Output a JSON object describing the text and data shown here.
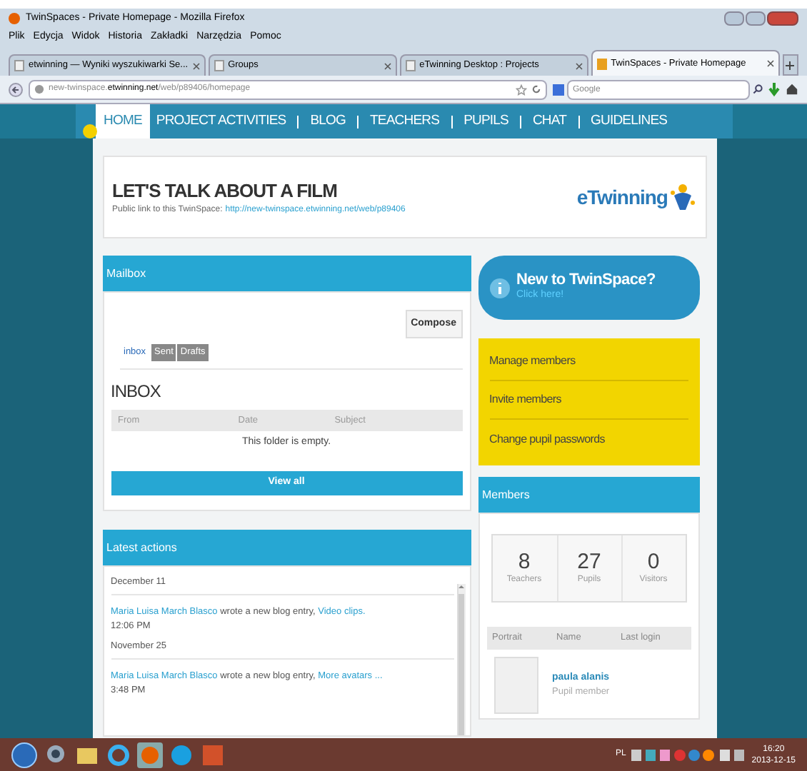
{
  "window": {
    "title": "TwinSpaces - Private Homepage - Mozilla Firefox"
  },
  "menu": [
    "Plik",
    "Edycja",
    "Widok",
    "Historia",
    "Zakładki",
    "Narzędzia",
    "Pomoc"
  ],
  "tabs": [
    {
      "label": "etwinning — Wyniki wyszukiwarki Se...",
      "selected": false
    },
    {
      "label": "Groups",
      "selected": false
    },
    {
      "label": "eTwinning Desktop : Projects",
      "selected": false
    },
    {
      "label": "TwinSpaces - Private Homepage",
      "selected": true
    }
  ],
  "address": {
    "host_prefix": "new-twinspace.",
    "host": "etwinning.net",
    "path": "/web/p89406/homepage"
  },
  "search": {
    "placeholder": "Google"
  },
  "nav": [
    {
      "label": "HOME",
      "selected": true
    },
    {
      "label": "PROJECT ACTIVITIES",
      "selected": false
    },
    {
      "label": "BLOG",
      "selected": false
    },
    {
      "label": "TEACHERS",
      "selected": false
    },
    {
      "label": "PUPILS",
      "selected": false
    },
    {
      "label": "CHAT",
      "selected": false
    },
    {
      "label": "GUIDELINES",
      "selected": false
    }
  ],
  "header": {
    "title": "LET'S TALK ABOUT A FILM",
    "link_label": "Public link to this TwinSpace:",
    "link": "http://new-twinspace.etwinning.net/web/p89406",
    "logo": "eTwinning"
  },
  "mailbox": {
    "title": "Mailbox",
    "compose": "Compose",
    "tabs": [
      {
        "label": "inbox",
        "selected": true
      },
      {
        "label": "Sent",
        "selected": false
      },
      {
        "label": "Drafts",
        "selected": false
      }
    ],
    "heading": "INBOX",
    "columns": [
      "From",
      "Date",
      "Subject"
    ],
    "empty": "This folder is empty.",
    "view_all": "View all"
  },
  "latest": {
    "title": "Latest actions",
    "entries": [
      {
        "date": "December 11",
        "author": "Maria Luisa March Blasco",
        "action": "wrote a new blog entry,",
        "link": "Video clips.",
        "time": "12:06 PM"
      },
      {
        "date": "November 25",
        "author": "Maria Luisa March Blasco",
        "action": "wrote a new blog entry,",
        "link": "More avatars ...",
        "time": "3:48 PM"
      }
    ]
  },
  "new_to": {
    "title": "New to TwinSpace?",
    "subtitle": "Click here!"
  },
  "admin_links": [
    "Manage members",
    "Invite members",
    "Change pupil passwords"
  ],
  "members": {
    "title": "Members",
    "counts": [
      {
        "value": "8",
        "label": "Teachers"
      },
      {
        "value": "27",
        "label": "Pupils"
      },
      {
        "value": "0",
        "label": "Visitors"
      }
    ],
    "columns": [
      "Portrait",
      "Name",
      "Last login"
    ],
    "rows": [
      {
        "name": "paula alanis",
        "role": "Pupil member"
      }
    ]
  },
  "tray": {
    "language": "PL",
    "time": "16:20",
    "date": "2013-12-15"
  }
}
